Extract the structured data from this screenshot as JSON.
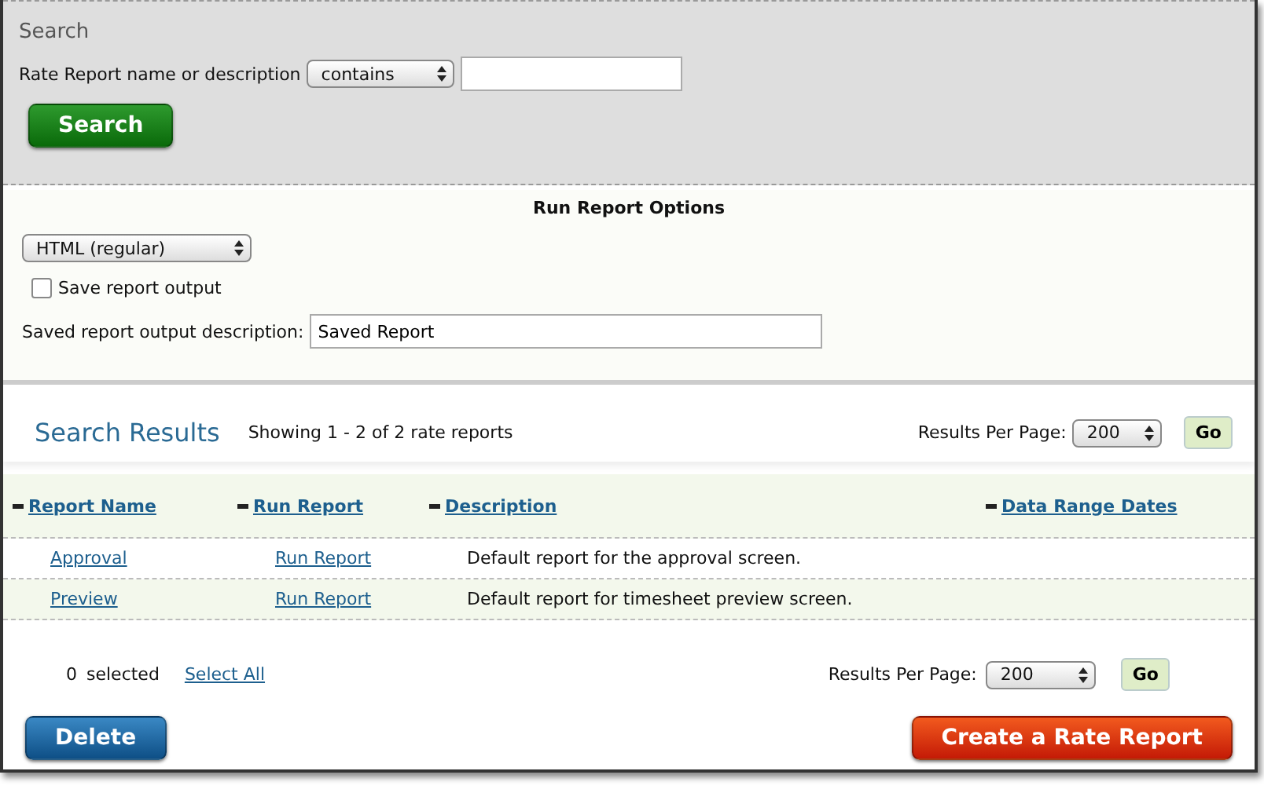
{
  "search": {
    "title": "Search",
    "field_label": "Rate Report name or description",
    "operator": "contains",
    "button": "Search"
  },
  "options": {
    "title": "Run Report Options",
    "format": "HTML (regular)",
    "save_output": {
      "label": "Save report output",
      "checked": false
    },
    "description_label": "Saved report output description:",
    "description_value": "Saved Report"
  },
  "results": {
    "title": "Search Results",
    "summary": "Showing 1 - 2 of 2 rate reports",
    "per_page_label": "Results Per Page:",
    "per_page": "200",
    "go": "Go",
    "columns": [
      "Report Name",
      "Run Report",
      "Description",
      "Data Range Dates"
    ],
    "rows": [
      {
        "name": "Approval",
        "run": "Run Report",
        "description": "Default report for the approval screen."
      },
      {
        "name": "Preview",
        "run": "Run Report",
        "description": "Default report for timesheet preview screen."
      }
    ]
  },
  "footer": {
    "selected_count": "0",
    "selected_label": "selected",
    "select_all": "Select All",
    "per_page_label": "Results Per Page:",
    "per_page": "200",
    "go": "Go"
  },
  "actions": {
    "delete": "Delete",
    "create": "Create a Rate Report"
  }
}
